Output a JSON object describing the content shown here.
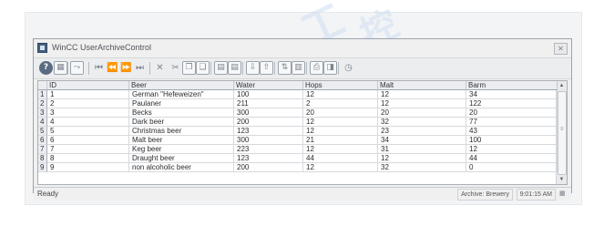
{
  "window": {
    "title": "WinCC UserArchiveControl",
    "close_glyph": "✕"
  },
  "toolbar": {
    "buttons": [
      {
        "name": "help-icon",
        "glyph": "?"
      },
      {
        "name": "config-dialog-icon",
        "glyph": "▦"
      },
      {
        "name": "select-archive-icon",
        "glyph": "⤳"
      },
      {
        "name": "first-record-icon",
        "glyph": "⏮"
      },
      {
        "name": "previous-record-icon",
        "glyph": "⏪"
      },
      {
        "name": "next-record-icon",
        "glyph": "⏩"
      },
      {
        "name": "last-record-icon",
        "glyph": "⏭"
      },
      {
        "name": "delete-icon",
        "glyph": "✕"
      },
      {
        "name": "cut-icon",
        "glyph": "✂"
      },
      {
        "name": "copy-icon",
        "glyph": "❐"
      },
      {
        "name": "paste-icon",
        "glyph": "❏"
      },
      {
        "name": "read-tags-icon",
        "glyph": "▤"
      },
      {
        "name": "write-tags-icon",
        "glyph": "▤"
      },
      {
        "name": "import-icon",
        "glyph": "⇩"
      },
      {
        "name": "export-icon",
        "glyph": "⇧"
      },
      {
        "name": "sort-dialog-icon",
        "glyph": "⇅"
      },
      {
        "name": "selection-dialog-icon",
        "glyph": "▥"
      },
      {
        "name": "print-icon",
        "glyph": "⎙"
      },
      {
        "name": "save-icon",
        "glyph": "◨"
      },
      {
        "name": "timebase-icon",
        "glyph": "◷"
      }
    ]
  },
  "table": {
    "columns": [
      "",
      "ID",
      "Beer",
      "Water",
      "Hops",
      "Malt",
      "Barm"
    ],
    "rows": [
      [
        "1",
        "1",
        "German \"Hefeweizen\"",
        "100",
        "12",
        "12",
        "34"
      ],
      [
        "2",
        "2",
        "Paulaner",
        "211",
        "2",
        "12",
        "122"
      ],
      [
        "3",
        "3",
        "Becks",
        "300",
        "20",
        "20",
        "20"
      ],
      [
        "4",
        "4",
        "Dark beer",
        "200",
        "12",
        "32",
        "77"
      ],
      [
        "5",
        "5",
        "Christmas beer",
        "123",
        "12",
        "23",
        "43"
      ],
      [
        "6",
        "6",
        "Malt beer",
        "300",
        "21",
        "34",
        "100"
      ],
      [
        "7",
        "7",
        "Keg beer",
        "223",
        "12",
        "31",
        "12"
      ],
      [
        "8",
        "8",
        "Draught beer",
        "123",
        "44",
        "12",
        "44"
      ],
      [
        "9",
        "9",
        "non alcoholic beer",
        "200",
        "12",
        "32",
        "0"
      ]
    ]
  },
  "status": {
    "ready": "Ready",
    "archive": "Archive: Brewery",
    "time": "9:01:15 AM"
  },
  "watermark": {
    "text1": "工",
    "text2": "控"
  },
  "colors": {
    "header_bg": "#ebedf0",
    "grid_line": "#d6dade",
    "watermark": "#cfe0f2"
  }
}
